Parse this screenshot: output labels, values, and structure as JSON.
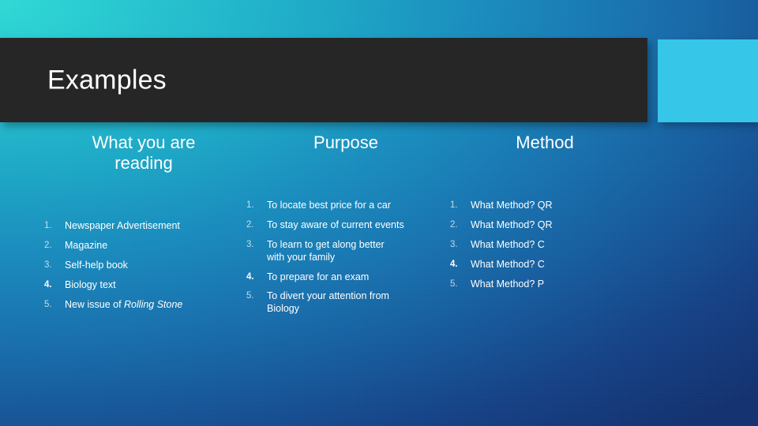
{
  "slide": {
    "title": "Examples",
    "theme": {
      "title_bar_color": "#262626",
      "accent_block_color": "#35c6e8",
      "background_from": "#2cd8d4",
      "background_to": "#102f6e",
      "text_color": "#ffffff"
    }
  },
  "columns": [
    {
      "id": "reading",
      "header": "What you are\nreading",
      "items": [
        {
          "number": "1.",
          "text": "Newspaper Advertisement",
          "emphasis": false
        },
        {
          "number": "2.",
          "text": "Magazine",
          "emphasis": false
        },
        {
          "number": "3.",
          "text": "Self-help book",
          "emphasis": false
        },
        {
          "number": "4.",
          "text": "Biology text",
          "emphasis": true
        },
        {
          "number": "5.",
          "text": "New issue of ",
          "italic_suffix": "Rolling Stone",
          "emphasis": false
        }
      ]
    },
    {
      "id": "purpose",
      "header": "Purpose",
      "items": [
        {
          "number": "1.",
          "text": "To locate best price for a car",
          "emphasis": false
        },
        {
          "number": "2.",
          "text": "To stay aware of current events",
          "emphasis": false
        },
        {
          "number": "3.",
          "text": "To learn to get along better\nwith your family",
          "emphasis": false
        },
        {
          "number": "4.",
          "text": "To prepare for an exam",
          "emphasis": true
        },
        {
          "number": "5.",
          "text": "To divert your attention from\nBiology",
          "emphasis": false
        }
      ]
    },
    {
      "id": "method",
      "header": "Method",
      "items": [
        {
          "number": "1.",
          "text": "What Method? QR",
          "emphasis": false
        },
        {
          "number": "2.",
          "text": "What Method? QR",
          "emphasis": false
        },
        {
          "number": "3.",
          "text": "What Method? C",
          "emphasis": false
        },
        {
          "number": "4.",
          "text": "What Method? C",
          "emphasis": true
        },
        {
          "number": "5.",
          "text": "What Method? P",
          "emphasis": false
        }
      ]
    }
  ],
  "layout": {
    "row_tops": {
      "reading": [
        0,
        25,
        50,
        75,
        100
      ],
      "purpose": [
        0,
        25,
        50,
        91,
        115
      ],
      "method": [
        0,
        25,
        50,
        75,
        100
      ]
    }
  }
}
